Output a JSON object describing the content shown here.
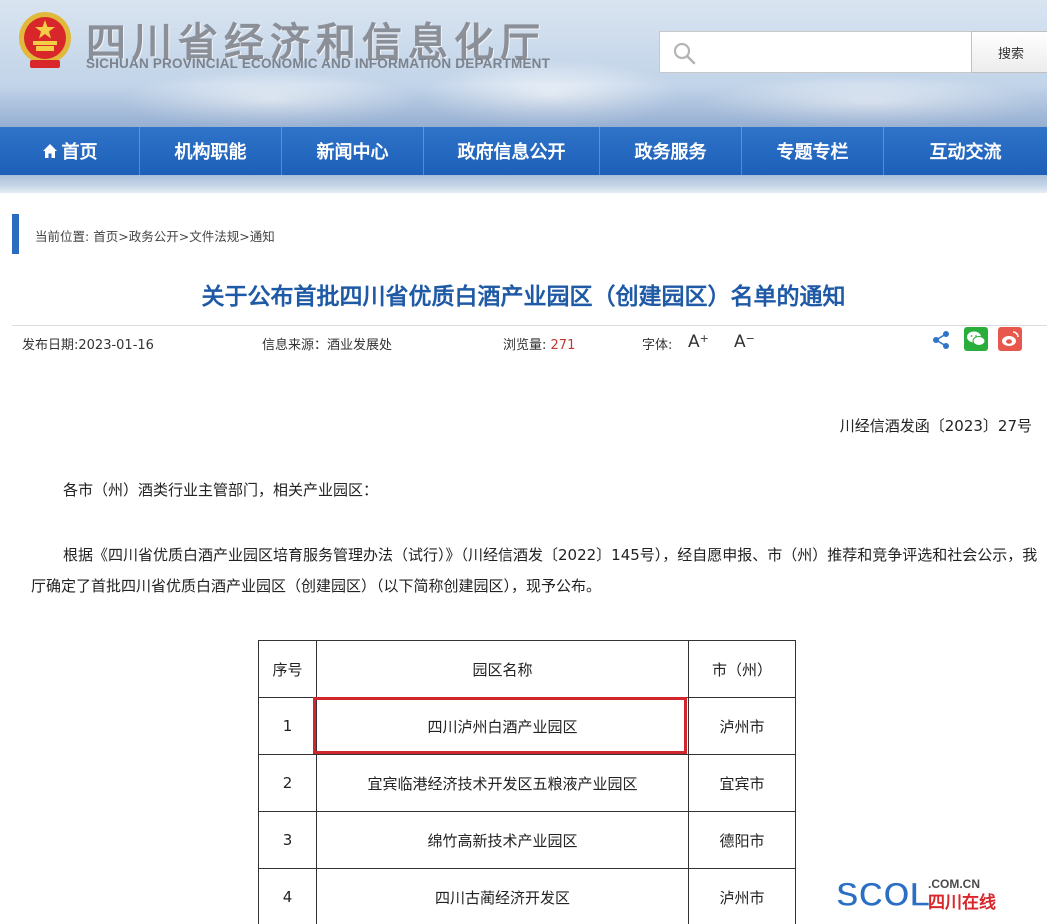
{
  "header": {
    "dept_name_cn": "四川省经济和信息化厅",
    "dept_name_en": "SICHUAN PROVINCIAL ECONOMIC AND INFORMATION DEPARTMENT",
    "emblem_icon": "national-emblem-icon",
    "search": {
      "placeholder": "",
      "value": "",
      "button_label": "搜索",
      "icon": "search-icon"
    }
  },
  "nav": {
    "items": [
      {
        "label": "首页",
        "icon": "home-icon"
      },
      {
        "label": "机构职能"
      },
      {
        "label": "新闻中心"
      },
      {
        "label": "政府信息公开"
      },
      {
        "label": "政务服务"
      },
      {
        "label": "专题专栏"
      },
      {
        "label": "互动交流"
      }
    ],
    "color": "#2566bd"
  },
  "breadcrumb": {
    "prefix": "当前位置:",
    "items": [
      "首页",
      "政务公开",
      "文件法规",
      "通知"
    ],
    "separator": ">"
  },
  "article": {
    "title": "关于公布首批四川省优质白酒产业园区（创建园区）名单的通知",
    "meta": {
      "date_label": "发布日期:",
      "date": "2023-01-16",
      "source_label": "信息来源：",
      "source": "酒业发展处",
      "views_label": "浏览量:",
      "views": "271",
      "font_label": "字体:",
      "font_increase": "A",
      "font_decrease": "A"
    },
    "share_icons": [
      "share-icon",
      "wechat-icon",
      "weibo-icon"
    ],
    "doc_number": "川经信酒发函〔2023〕27号",
    "salutation": "各市（州）酒类行业主管部门，相关产业园区：",
    "paragraph": "根据《四川省优质白酒产业园区培育服务管理办法（试行）》（川经信酒发〔2022〕145号），经自愿申报、市（州）推荐和竞争评选和社会公示，我厅确定了首批四川省优质白酒产业园区（创建园区）（以下简称创建园区），现予公布。"
  },
  "table": {
    "headers": [
      "序号",
      "园区名称",
      "市（州）"
    ],
    "rows": [
      {
        "no": "1",
        "name": "四川泸州白酒产业园区",
        "city": "泸州市"
      },
      {
        "no": "2",
        "name": "宜宾临港经济技术开发区五粮液产业园区",
        "city": "宜宾市"
      },
      {
        "no": "3",
        "name": "绵竹高新技术产业园区",
        "city": "德阳市"
      },
      {
        "no": "4",
        "name": "四川古蔺经济开发区",
        "city": "泸州市"
      }
    ],
    "highlight_color": "#d3262c"
  },
  "watermark": {
    "text_en": "SCOL",
    "domain": ".COM.CN",
    "text_cn": "四川在线"
  }
}
